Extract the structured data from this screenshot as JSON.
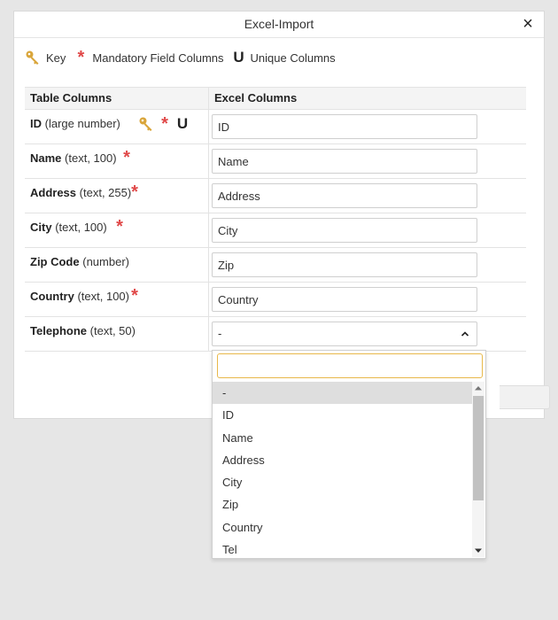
{
  "dialog": {
    "title": "Excel-Import",
    "close_label": "×"
  },
  "legend": {
    "key_label": "Key",
    "star_glyph": "*",
    "mandatory_label": "Mandatory Field Columns",
    "unique_glyph": "U",
    "unique_label": "Unique Columns"
  },
  "table": {
    "headers": [
      "Table Columns",
      "Excel Columns"
    ],
    "rows": [
      {
        "name": "ID",
        "type": "(large number)",
        "excel": "ID"
      },
      {
        "name": "Name",
        "type": "(text, 100)",
        "excel": "Name"
      },
      {
        "name": "Address",
        "type": "(text, 255)",
        "excel": "Address"
      },
      {
        "name": "City",
        "type": "(text, 100)",
        "excel": "City"
      },
      {
        "name": "Zip Code",
        "type": "(number)",
        "excel": "Zip"
      },
      {
        "name": "Country",
        "type": "(text, 100)",
        "excel": "Country"
      },
      {
        "name": "Telephone",
        "type": "(text, 50)",
        "excel": "-"
      }
    ]
  },
  "dropdown": {
    "search_value": "",
    "options": [
      "-",
      "ID",
      "Name",
      "Address",
      "City",
      "Zip",
      "Country",
      "Tel"
    ],
    "selected": "-"
  },
  "colors": {
    "mandatory": "#e04848",
    "key": "#d9a53a",
    "search_focus": "#e8b84a"
  }
}
